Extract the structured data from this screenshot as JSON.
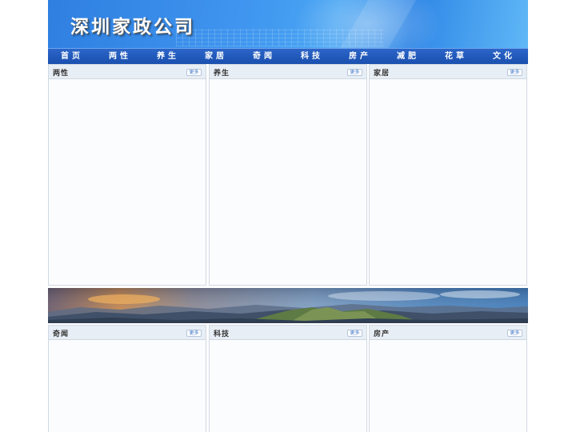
{
  "site": {
    "title": "深圳家政公司"
  },
  "nav": [
    "首页",
    "两性",
    "养生",
    "家居",
    "奇闻",
    "科技",
    "房产",
    "减肥",
    "花草",
    "文化"
  ],
  "sections": [
    {
      "title": "两性",
      "more": "更多"
    },
    {
      "title": "养生",
      "more": "更多"
    },
    {
      "title": "家居",
      "more": "更多"
    },
    {
      "title": "奇闻",
      "more": "更多"
    },
    {
      "title": "科技",
      "more": "更多"
    },
    {
      "title": "房产",
      "more": "更多"
    }
  ],
  "colors": {
    "nav": "#1f57b8",
    "banner": "#3f95ef",
    "panel_head": "#e8eef5"
  }
}
